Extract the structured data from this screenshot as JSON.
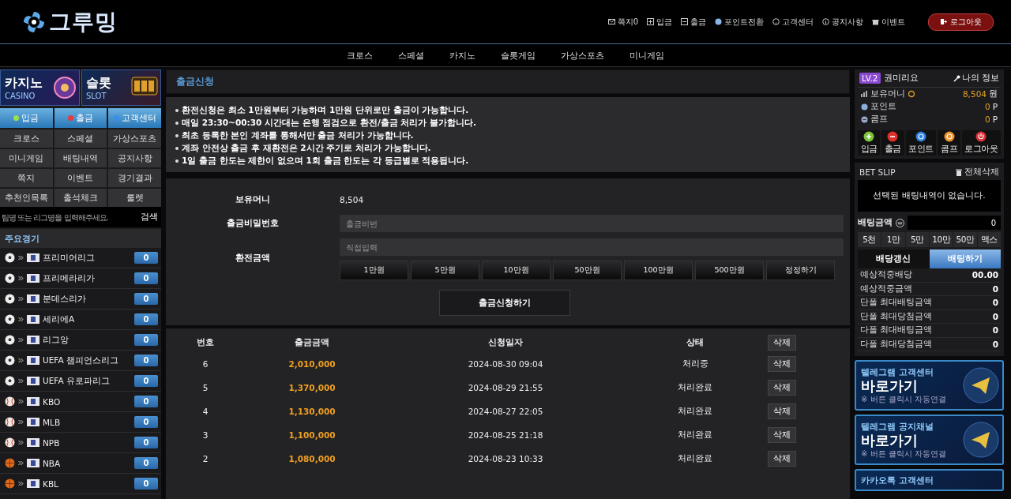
{
  "header": {
    "logo": "그루밍",
    "links": [
      {
        "kind": "mail",
        "label": "쪽지0"
      },
      {
        "kind": "plus",
        "label": "입금"
      },
      {
        "kind": "minus",
        "label": "출금"
      },
      {
        "kind": "coin",
        "label": "포인트전환"
      },
      {
        "kind": "help",
        "label": "고객센터"
      },
      {
        "kind": "info",
        "label": "공지사항"
      },
      {
        "kind": "gift",
        "label": "이벤트"
      }
    ],
    "logout": "로그아웃"
  },
  "nav": [
    "크로스",
    "스페셜",
    "카지노",
    "슬롯게임",
    "가상스포츠",
    "미니게임"
  ],
  "sidebar": {
    "banners": [
      {
        "title": "카지노",
        "subtitle": "CASINO",
        "kind": "casino"
      },
      {
        "title": "슬롯",
        "subtitle": "SLOT",
        "kind": "slot"
      }
    ],
    "quick": [
      {
        "label": "입금",
        "color": "#9be04a"
      },
      {
        "label": "출금",
        "color": "#e83a3a"
      },
      {
        "label": "고객센터",
        "color": "#3a8ee8"
      }
    ],
    "menu": [
      "크로스",
      "스페셜",
      "가상스포츠",
      "미니게임",
      "배팅내역",
      "공지사항",
      "쪽지",
      "이벤트",
      "경기결과",
      "추천인목록",
      "출석체크",
      "룰렛"
    ],
    "search": {
      "placeholder": "팀명 또는 리그명을 입력해주세요.",
      "button": "검색"
    },
    "section_title": "주요경기",
    "leagues": [
      {
        "kind": "soccer",
        "name": "프리미어리그",
        "count": "0"
      },
      {
        "kind": "soccer",
        "name": "프리메라리가",
        "count": "0"
      },
      {
        "kind": "soccer",
        "name": "분데스리가",
        "count": "0"
      },
      {
        "kind": "soccer",
        "name": "세리에A",
        "count": "0"
      },
      {
        "kind": "soccer",
        "name": "리그앙",
        "count": "0"
      },
      {
        "kind": "soccer",
        "name": "UEFA 챔피언스리그",
        "count": "0"
      },
      {
        "kind": "soccer",
        "name": "UEFA 유로파리그",
        "count": "0"
      },
      {
        "kind": "baseball",
        "name": "KBO",
        "count": "0"
      },
      {
        "kind": "baseball",
        "name": "MLB",
        "count": "0"
      },
      {
        "kind": "baseball",
        "name": "NPB",
        "count": "0"
      },
      {
        "kind": "basketball",
        "name": "NBA",
        "count": "0"
      },
      {
        "kind": "basketball",
        "name": "KBL",
        "count": "0"
      }
    ]
  },
  "page": {
    "title": "출금신청",
    "notices": [
      "환전신청은 최소 1만원부터 가능하며 1만원 단위로만 출금이 가능합니다.",
      "매일 23:30~00:30 시간대는 은행 점검으로 환전/출금 처리가 불가합니다.",
      "최초 등록한 본인 계좌를 통해서만 출금 처리가 가능합니다.",
      "계좌 안전상 출금 후 재환전은 2시간 주기로 처리가 가능합니다.",
      "1일 출금 한도는 제한이 없으며 1회 출금 한도는 각 등급별로 적용됩니다."
    ],
    "form": {
      "balance_label": "보유머니",
      "balance": "8,504",
      "password_label": "출금비밀번호",
      "password_placeholder": "출금비번",
      "amount_label": "환전금액",
      "amount_placeholder": "직접입력",
      "amount_buttons": [
        "1만원",
        "5만원",
        "10만원",
        "50만원",
        "100만원",
        "500만원",
        "정정하기"
      ],
      "submit": "출금신청하기"
    },
    "table": {
      "columns": [
        "번호",
        "출금금액",
        "신청일자",
        "상태"
      ],
      "header_button": "삭제",
      "rows": [
        {
          "no": "6",
          "amount": "2,010,000",
          "date": "2024-08-30 09:04",
          "status": "처리중",
          "action": "삭제"
        },
        {
          "no": "5",
          "amount": "1,370,000",
          "date": "2024-08-29 21:55",
          "status": "처리완료",
          "action": "삭제"
        },
        {
          "no": "4",
          "amount": "1,130,000",
          "date": "2024-08-27 22:05",
          "status": "처리완료",
          "action": "삭제"
        },
        {
          "no": "3",
          "amount": "1,100,000",
          "date": "2024-08-25 21:18",
          "status": "처리완료",
          "action": "삭제"
        },
        {
          "no": "2",
          "amount": "1,080,000",
          "date": "2024-08-23 10:33",
          "status": "처리완료",
          "action": "삭제"
        }
      ]
    }
  },
  "account": {
    "level": "LV.2",
    "name": "권미리요",
    "my_info": "나의 정보",
    "balances": [
      {
        "kind": "money",
        "label": "보유머니",
        "value": "8,504",
        "unit": "원"
      },
      {
        "kind": "point",
        "label": "포인트",
        "value": "0",
        "unit": "P"
      },
      {
        "kind": "comp",
        "label": "콤프",
        "value": "0",
        "unit": "P"
      }
    ],
    "buttons": [
      {
        "kind": "plus",
        "label": "입금",
        "color": "#7cc43a"
      },
      {
        "kind": "minus",
        "label": "출금",
        "color": "#e0302a"
      },
      {
        "kind": "coin",
        "label": "포인트",
        "color": "#2f7fe0"
      },
      {
        "kind": "coin",
        "label": "콤프",
        "color": "#f0902a"
      },
      {
        "kind": "power",
        "label": "로그아웃",
        "color": "#e0303a"
      }
    ]
  },
  "bet_slip": {
    "title": "BET SLIP",
    "clear": "전체삭제",
    "empty": "선택된 배팅내역이 없습니다.",
    "amount_label": "배팅금액",
    "amount": "0",
    "chips": [
      "5천",
      "1만",
      "5만",
      "10만",
      "50만",
      "맥스"
    ],
    "actions": [
      {
        "kind": "secondary",
        "label": "배당갱신"
      },
      {
        "kind": "primary",
        "label": "배팅하기"
      }
    ],
    "stats": [
      {
        "label": "예상적중배당",
        "value": "00.00"
      },
      {
        "label": "예상적중금액",
        "value": "0"
      },
      {
        "label": "단폴 최대배팅금액",
        "value": "0"
      },
      {
        "label": "단폴 최대당첨금액",
        "value": "0"
      },
      {
        "label": "다폴 최대배팅금액",
        "value": "0"
      },
      {
        "label": "다폴 최대당첨금액",
        "value": "0"
      }
    ]
  },
  "promo_banners": [
    {
      "title": "텔레그램 고객센터",
      "cta": "바로가기",
      "note": "※ 버튼 클릭시 자동연결"
    },
    {
      "title": "텔레그램 공지채널",
      "cta": "바로가기",
      "note": "※ 버튼 클릭시 자동연결"
    },
    {
      "title": "카카오톡 고객센터"
    }
  ]
}
